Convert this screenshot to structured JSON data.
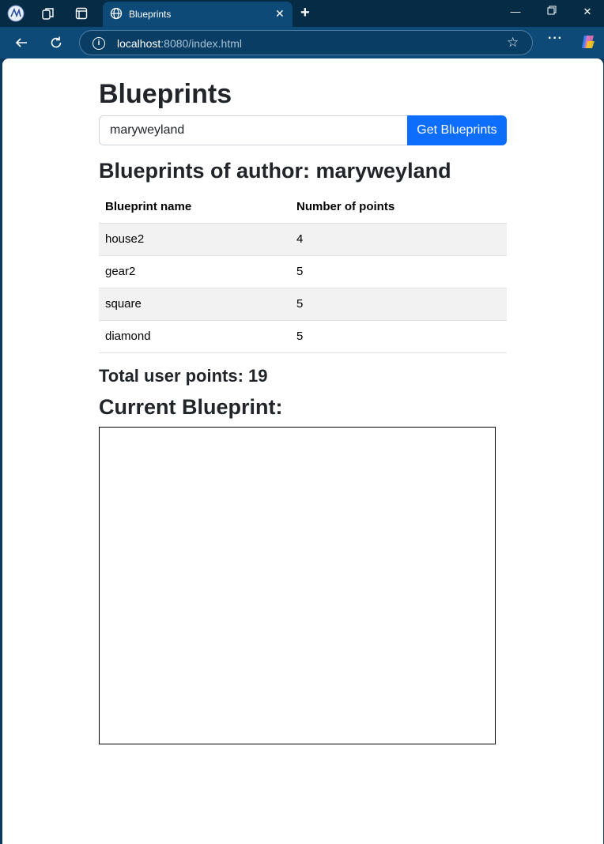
{
  "browser": {
    "tab_title": "Blueprints",
    "url_host": "localhost",
    "url_rest": ":8080/index.html"
  },
  "page": {
    "title": "Blueprints",
    "search_value": "maryweyland",
    "search_button": "Get Blueprints",
    "author_heading": "Blueprints of author: maryweyland",
    "table": {
      "headers": [
        "Blueprint name",
        "Number of points"
      ],
      "rows": [
        {
          "name": "house2",
          "points": "4"
        },
        {
          "name": "gear2",
          "points": "5"
        },
        {
          "name": "square",
          "points": "5"
        },
        {
          "name": "diamond",
          "points": "5"
        }
      ]
    },
    "total_points": "Total user points: 19",
    "current_blueprint": "Current Blueprint:"
  },
  "colors": {
    "accent": "#0d6efd",
    "chrome_dark": "#062b45",
    "chrome": "#0e4a78"
  },
  "icons": {
    "profile": "profile-avatar-icon",
    "workspaces": "workspaces-icon",
    "tab_actions": "tab-actions-icon",
    "tab_favicon": "globe-icon",
    "close": "close-icon",
    "new_tab": "plus-icon",
    "back": "back-arrow-icon",
    "refresh": "refresh-icon",
    "site_info": "info-icon",
    "favorite": "star-icon",
    "menu": "more-icon",
    "copilot": "copilot-icon"
  }
}
